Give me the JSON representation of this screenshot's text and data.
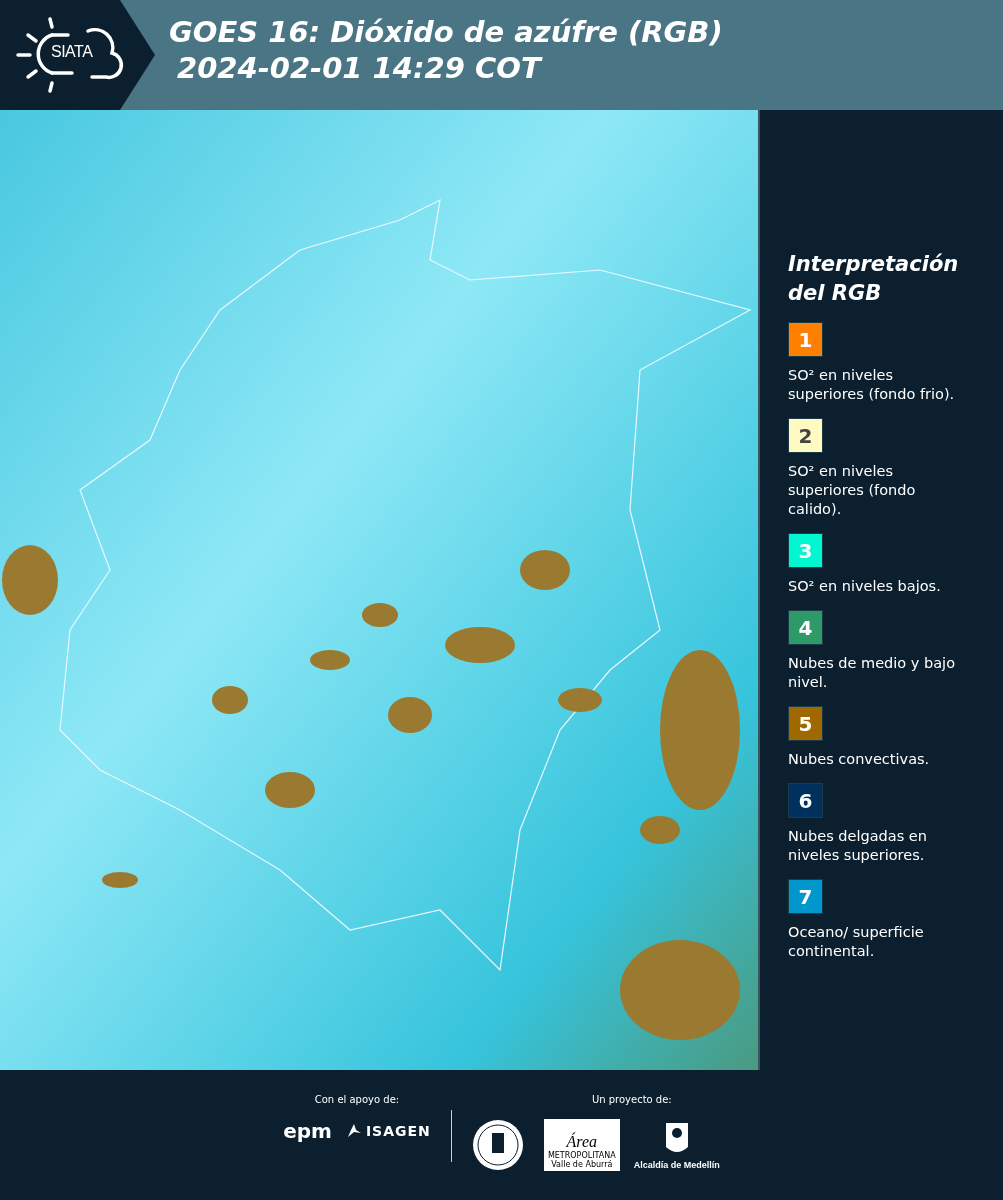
{
  "header": {
    "logo_text": "SIATA",
    "title": "GOES 16: Dióxido de azúfre (RGB)",
    "timestamp": "2024-02-01 14:29 COT"
  },
  "legend": {
    "title": "Interpretación del RGB",
    "items": [
      {
        "number": "1",
        "color": "#ff7f00",
        "text": "SO² en niveles superiores (fondo frio)."
      },
      {
        "number": "2",
        "color": "#fff9c2",
        "text": "SO² en niveles superiores (fondo calido)."
      },
      {
        "number": "3",
        "color": "#00f7d2",
        "text": "SO² en niveles bajos."
      },
      {
        "number": "4",
        "color": "#2e9a68",
        "text": "Nubes de medio y bajo nivel."
      },
      {
        "number": "5",
        "color": "#a06800",
        "text": "Nubes convectivas."
      },
      {
        "number": "6",
        "color": "#00305e",
        "text": "Nubes delgadas en niveles superiores."
      },
      {
        "number": "7",
        "color": "#0098cc",
        "text": "Oceano/ superficie continental."
      }
    ]
  },
  "footer": {
    "support_label": "Con el apoyo de:",
    "support_logos": [
      "epm",
      "ISAGEN"
    ],
    "project_label": "Un proyecto de:",
    "area_logo": {
      "name": "Área",
      "line1": "METROPOLITANA",
      "line2": "Valle de Aburrá"
    },
    "alcaldia": "Alcaldía de Medellín"
  }
}
